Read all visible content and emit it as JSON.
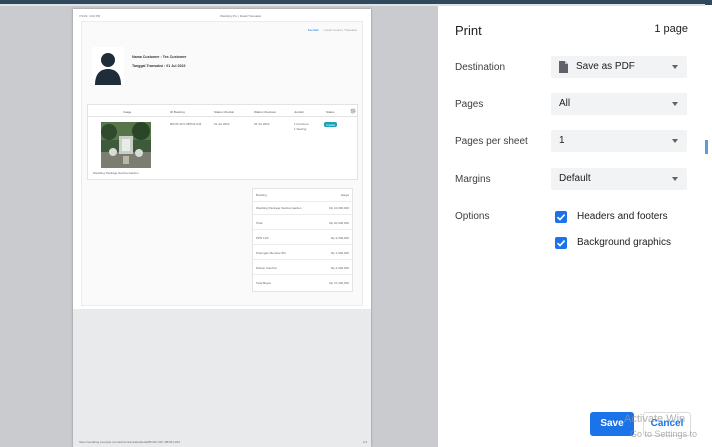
{
  "preview": {
    "header_left": "7/1/22, 4:22 PM",
    "header_mid": "Wedding Pro | Detail Transaksi",
    "doc_links": [
      "Kembali",
      "Cetak Invoice | Transaksi"
    ],
    "customer_line": "Nama Customer : Tes Customer",
    "date_line": "Tanggal Transaksi : 01 Jul 2022",
    "table": {
      "headers": [
        "Image",
        "ID Booking",
        "Status Checkin",
        "Waktu Checkout",
        "Jumlah",
        "Status"
      ],
      "row": {
        "id": "BOOK-0D7-0B7D4-043",
        "checkin": "01 Jul 2022",
        "checkout": "05 Jul 2022",
        "qty_line1": "1 Furniture",
        "qty_line2": "1 Sewing",
        "status": "Unpaid"
      },
      "caption": "Wedding Package Samba Garden"
    },
    "summary": [
      {
        "label": "Booking",
        "value": "Harga"
      },
      {
        "label": "Wedding Package Samba Garden",
        "value": "Rp 10,000,000"
      },
      {
        "label": "Total",
        "value": "Rp 20,000,000"
      },
      {
        "label": "PPN 11%",
        "value": "Rp 2,200,000"
      },
      {
        "label": "Potongan Member 8%",
        "value": "Rp 1,600,000"
      },
      {
        "label": "Diskon Voucher",
        "value": "Rp 4,000,000"
      },
      {
        "label": "Total Bayar",
        "value": "Rp 27,200,000"
      }
    ],
    "footer_url": "https://wedding.example.com/admin/transaksi/detail/BOOK-0D7-0B7D4-043",
    "footer_page": "1/1"
  },
  "print": {
    "title": "Print",
    "page_count": "1 page",
    "destination": {
      "label": "Destination",
      "value": "Save as PDF",
      "icon": "file-icon"
    },
    "pages": {
      "label": "Pages",
      "value": "All"
    },
    "per_sheet": {
      "label": "Pages per sheet",
      "value": "1"
    },
    "margins": {
      "label": "Margins",
      "value": "Default"
    },
    "options": {
      "label": "Options",
      "headers_footers": "Headers and footers",
      "headers_footers_checked": true,
      "background": "Background graphics",
      "background_checked": true
    },
    "save": "Save",
    "cancel": "Cancel"
  },
  "watermark": {
    "line1": "Activate Win",
    "line2": "Go to Settings to"
  },
  "colors": {
    "accent": "#1a73e8",
    "badge": "#17a2b8",
    "preview_bg": "#c9cbcf"
  }
}
